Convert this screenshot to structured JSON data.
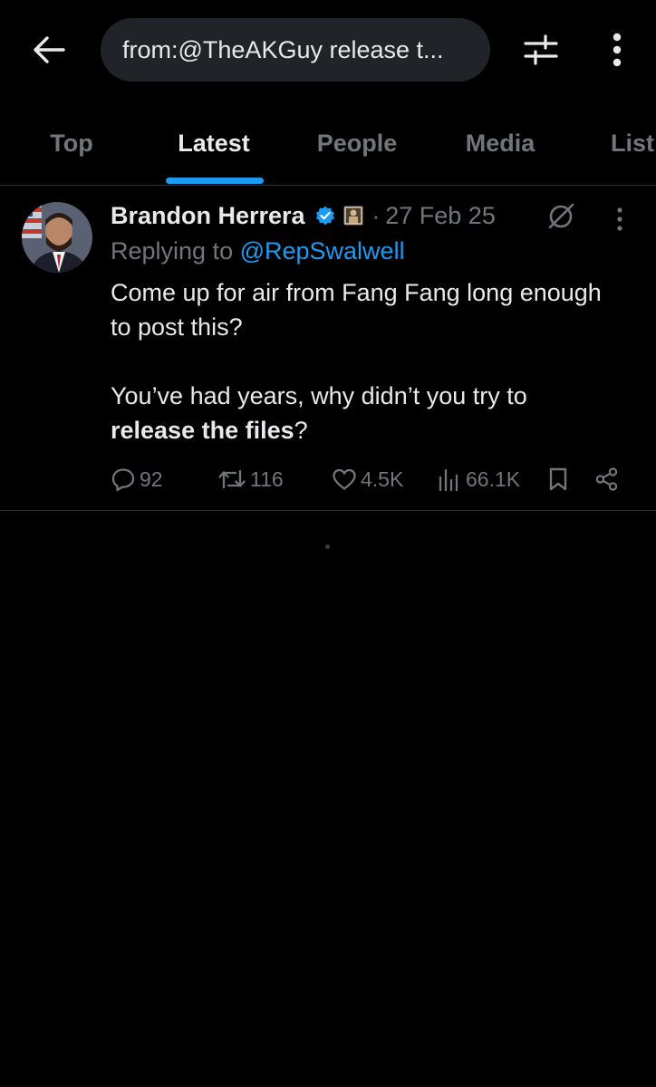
{
  "search": {
    "query": "from:@TheAKGuy release t..."
  },
  "tabs": [
    {
      "label": "Top"
    },
    {
      "label": "Latest"
    },
    {
      "label": "People"
    },
    {
      "label": "Media"
    },
    {
      "label": "List"
    }
  ],
  "tweet": {
    "author": "Brandon Herrera",
    "separator": "·",
    "date": "27 Feb 25",
    "replying_prefix": "Replying to ",
    "replying_to": "@RepSwalwell",
    "line1": "Come up for air from Fang Fang long enough to post this?",
    "line2_prefix": "You’ve had years, why didn’t you try to",
    "line2_bold": "release the files",
    "line2_suffix": "?",
    "stats": {
      "replies": "92",
      "retweets": "116",
      "likes": "4.5K",
      "views": "66.1K"
    }
  },
  "colors": {
    "accent": "#1d9bf0",
    "muted": "#71767b",
    "text": "#e7e9ea",
    "background": "#000000"
  },
  "icons": [
    "back-arrow-icon",
    "filter-sliders-icon",
    "more-vertical-icon",
    "verified-badge-icon",
    "grok-icon",
    "reply-icon",
    "retweet-icon",
    "like-icon",
    "views-icon",
    "bookmark-icon",
    "share-icon"
  ]
}
